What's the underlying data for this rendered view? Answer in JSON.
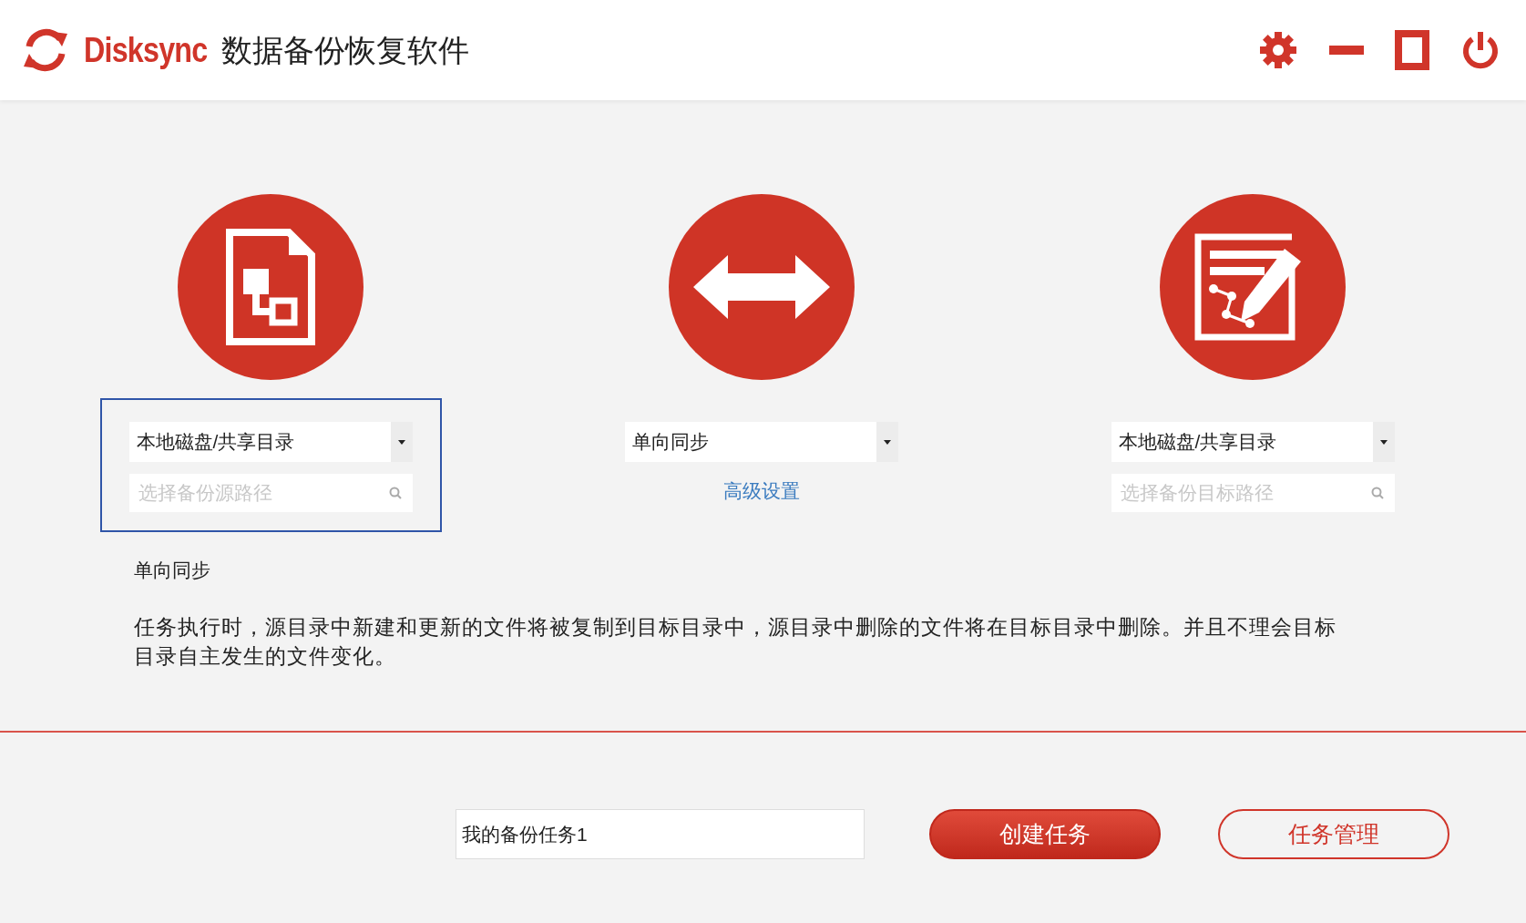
{
  "header": {
    "brand": "Disksync",
    "title": "数据备份恢复软件"
  },
  "source": {
    "focused": true,
    "dropdown": "本地磁盘/共享目录",
    "path_placeholder": "选择备份源路径"
  },
  "mode": {
    "dropdown": "单向同步",
    "link": "高级设置"
  },
  "target": {
    "dropdown": "本地磁盘/共享目录",
    "path_placeholder": "选择备份目标路径"
  },
  "description": {
    "title": "单向同步",
    "text": "任务执行时，源目录中新建和更新的文件将被复制到目标目录中，源目录中删除的文件将在目标目录中删除。并且不理会目标目录自主发生的文件变化。"
  },
  "footer": {
    "task_name": "我的备份任务1",
    "buttons": [
      {
        "label": "创建任务",
        "kind": "primary"
      },
      {
        "label": "任务管理",
        "kind": "outline"
      }
    ]
  }
}
